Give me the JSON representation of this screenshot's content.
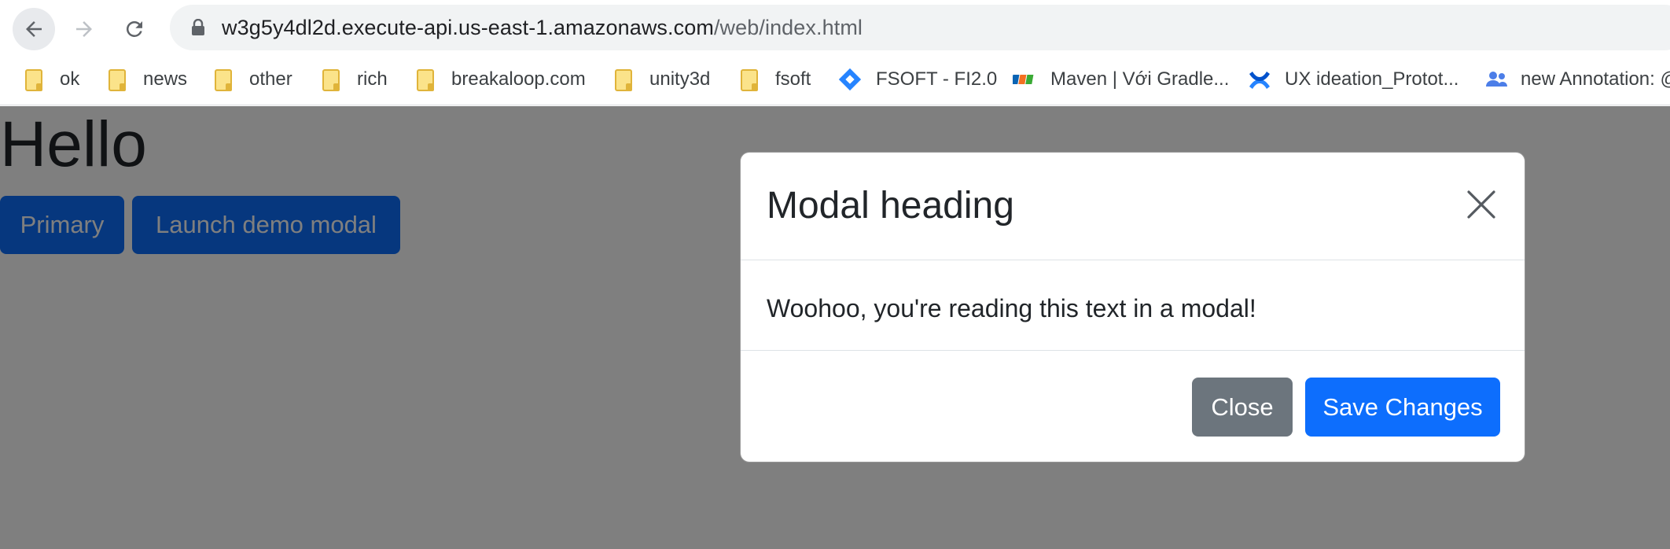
{
  "browser": {
    "url_host": "w3g5y4dl2d.execute-api.us-east-1.amazonaws.com",
    "url_path": "/web/index.html",
    "bookmarks": [
      {
        "label": "ok",
        "icon": "folder-icon"
      },
      {
        "label": "news",
        "icon": "folder-icon"
      },
      {
        "label": "other",
        "icon": "folder-icon"
      },
      {
        "label": "rich",
        "icon": "folder-icon"
      },
      {
        "label": "breakaloop.com",
        "icon": "folder-icon"
      },
      {
        "label": "unity3d",
        "icon": "folder-icon"
      },
      {
        "label": "fsoft",
        "icon": "folder-icon"
      },
      {
        "label": "FSOFT - FI2.0",
        "icon": "jira-diamond-icon"
      },
      {
        "label": "Maven | Với Gradle...",
        "icon": "fpt-logo-icon"
      },
      {
        "label": "UX ideation_Protot...",
        "icon": "confluence-icon"
      },
      {
        "label": "new Annotation: @",
        "icon": "people-icon"
      }
    ]
  },
  "page": {
    "heading": "Hello",
    "primary_label": "Primary",
    "launch_label": "Launch demo modal"
  },
  "modal": {
    "title": "Modal heading",
    "body": "Woohoo, you're reading this text in a modal!",
    "close_label": "Close",
    "save_label": "Save Changes"
  },
  "colors": {
    "primary": "#0d6efd",
    "secondary": "#6c757d",
    "backdrop": "rgba(0,0,0,0.5)"
  }
}
